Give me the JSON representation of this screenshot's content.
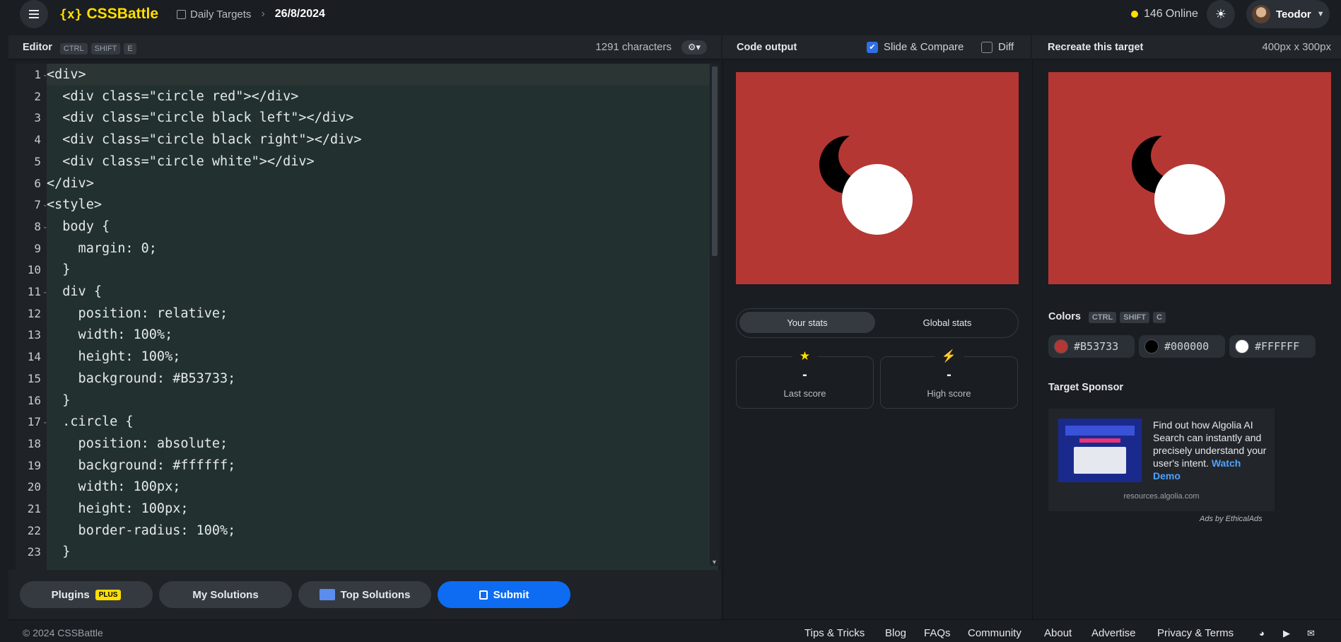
{
  "header": {
    "logo": "CSSBattle",
    "logo_mark": "{x}",
    "breadcrumb_section": "Daily Targets",
    "breadcrumb_date": "26/8/2024",
    "online_count": "146",
    "online_label": "Online",
    "user_name": "Teodor"
  },
  "editor": {
    "title": "Editor",
    "shortcut": [
      "CTRL",
      "SHIFT",
      "E"
    ],
    "char_count": "1291 characters",
    "lines": [
      {
        "n": "1",
        "fold": true
      },
      {
        "n": "2",
        "fold": false
      },
      {
        "n": "3",
        "fold": false
      },
      {
        "n": "4",
        "fold": false
      },
      {
        "n": "5",
        "fold": false
      },
      {
        "n": "6",
        "fold": false
      },
      {
        "n": "7",
        "fold": true
      },
      {
        "n": "8",
        "fold": true
      },
      {
        "n": "9",
        "fold": false
      },
      {
        "n": "10",
        "fold": false
      },
      {
        "n": "11",
        "fold": true
      },
      {
        "n": "12",
        "fold": false
      },
      {
        "n": "13",
        "fold": false
      },
      {
        "n": "14",
        "fold": false
      },
      {
        "n": "15",
        "fold": false
      },
      {
        "n": "16",
        "fold": false
      },
      {
        "n": "17",
        "fold": true
      },
      {
        "n": "18",
        "fold": false
      },
      {
        "n": "19",
        "fold": false
      },
      {
        "n": "20",
        "fold": false
      },
      {
        "n": "21",
        "fold": false
      },
      {
        "n": "22",
        "fold": false
      },
      {
        "n": "23",
        "fold": false
      }
    ],
    "code": [
      "<div>",
      "  <div class=\"circle red\"></div>",
      "  <div class=\"circle black left\"></div>",
      "  <div class=\"circle black right\"></div>",
      "  <div class=\"circle white\"></div>",
      "</div>",
      "<style>",
      "  body {",
      "    margin: 0;",
      "  }",
      "  div {",
      "    position: relative;",
      "    width: 100%;",
      "    height: 100%;",
      "    background: #B53733;",
      "  }",
      "  .circle {",
      "    position: absolute;",
      "    background: #ffffff;",
      "    width: 100px;",
      "    height: 100px;",
      "    border-radius: 100%;",
      "  }"
    ]
  },
  "actions": {
    "plugins": "Plugins",
    "plugins_badge": "PLUS",
    "my_solutions": "My Solutions",
    "top_solutions": "Top Solutions",
    "submit": "Submit"
  },
  "output": {
    "title": "Code output",
    "slide_compare": "Slide & Compare",
    "slide_compare_checked": true,
    "diff": "Diff",
    "diff_checked": false,
    "tab_your": "Your stats",
    "tab_global": "Global stats",
    "last_score_value": "-",
    "last_score_label": "Last score",
    "high_score_value": "-",
    "high_score_label": "High score"
  },
  "target": {
    "title": "Recreate this target",
    "size": "400px x 300px",
    "colors_title": "Colors",
    "colors_shortcut": [
      "CTRL",
      "SHIFT",
      "C"
    ],
    "colors": [
      {
        "hex": "#B53733"
      },
      {
        "hex": "#000000"
      },
      {
        "hex": "#FFFFFF"
      }
    ],
    "sponsor_title": "Target Sponsor",
    "sponsor_text": "Find out how Algolia AI Search can instantly and precisely understand your user's intent.",
    "sponsor_link": "Watch Demo",
    "sponsor_domain": "resources.algolia.com",
    "ads_by": "Ads by EthicalAds"
  },
  "footer": {
    "copyright": "© 2024 CSSBattle",
    "links": [
      "Tips & Tricks",
      "Blog",
      "FAQs",
      "Community",
      "About",
      "Advertise",
      "Privacy & Terms"
    ]
  },
  "colors": {
    "accent": "#ffdf00",
    "primary": "#0d6cf2",
    "target_red": "#B53733",
    "target_black": "#000000",
    "target_white": "#FFFFFF"
  }
}
